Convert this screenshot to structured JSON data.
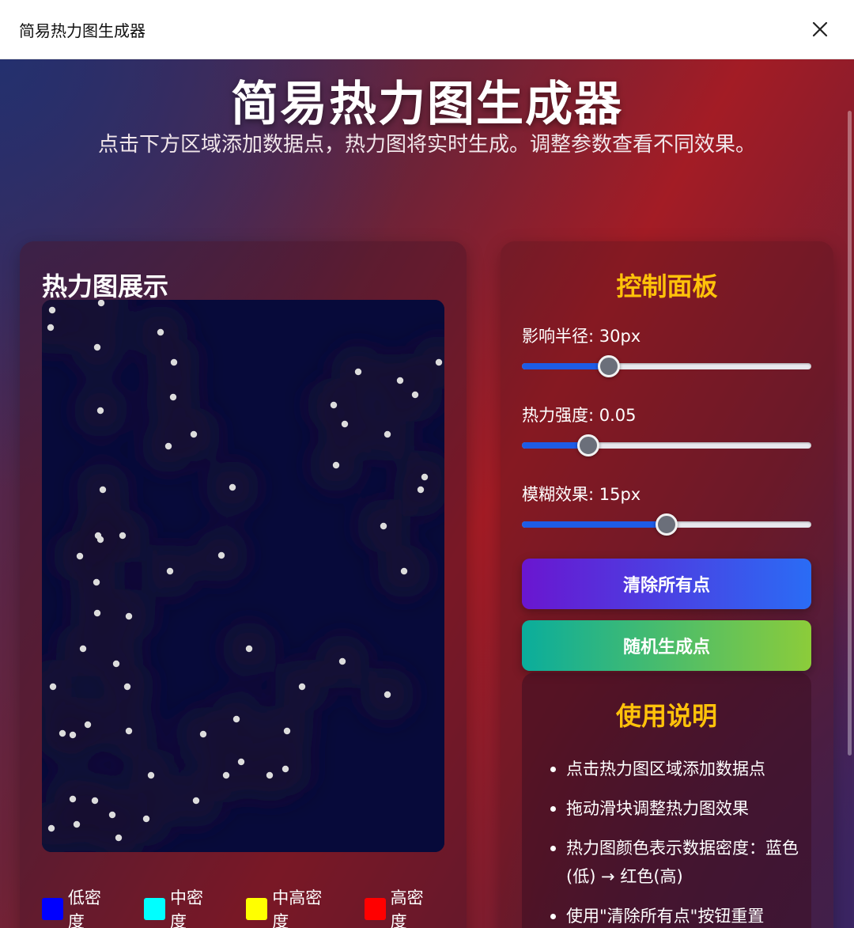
{
  "window": {
    "title": "简易热力图生成器"
  },
  "header": {
    "title": "简易热力图生成器",
    "subtitle": "点击下方区域添加数据点，热力图将实时生成。调整参数查看不同效果。"
  },
  "heatmap": {
    "title": "热力图展示",
    "background_color": "#070a3a",
    "point_color": "#dcdcdc",
    "points": [
      [
        13,
        13
      ],
      [
        75,
        4
      ],
      [
        11,
        35
      ],
      [
        150,
        41
      ],
      [
        70,
        60
      ],
      [
        167,
        79
      ],
      [
        166,
        123
      ],
      [
        74,
        140
      ],
      [
        400,
        91
      ],
      [
        453,
        102
      ],
      [
        472,
        120
      ],
      [
        502,
        79
      ],
      [
        369,
        133
      ],
      [
        383,
        157
      ],
      [
        437,
        170
      ],
      [
        192,
        170
      ],
      [
        160,
        185
      ],
      [
        77,
        240
      ],
      [
        241,
        237
      ],
      [
        372,
        209
      ],
      [
        484,
        224
      ],
      [
        479,
        240
      ],
      [
        71,
        298
      ],
      [
        74,
        303
      ],
      [
        102,
        298
      ],
      [
        48,
        324
      ],
      [
        227,
        323
      ],
      [
        162,
        343
      ],
      [
        69,
        357
      ],
      [
        432,
        286
      ],
      [
        458,
        343
      ],
      [
        70,
        396
      ],
      [
        110,
        400
      ],
      [
        52,
        441
      ],
      [
        94,
        460
      ],
      [
        262,
        441
      ],
      [
        380,
        457
      ],
      [
        14,
        489
      ],
      [
        108,
        489
      ],
      [
        329,
        489
      ],
      [
        437,
        499
      ],
      [
        246,
        530
      ],
      [
        58,
        537
      ],
      [
        26,
        548
      ],
      [
        39,
        550
      ],
      [
        110,
        545
      ],
      [
        204,
        549
      ],
      [
        310,
        545
      ],
      [
        252,
        584
      ],
      [
        308,
        593
      ],
      [
        138,
        601
      ],
      [
        233,
        601
      ],
      [
        288,
        601
      ],
      [
        39,
        631
      ],
      [
        67,
        633
      ],
      [
        195,
        633
      ],
      [
        89,
        651
      ],
      [
        132,
        656
      ],
      [
        12,
        668
      ],
      [
        44,
        663
      ],
      [
        97,
        680
      ]
    ]
  },
  "legend": [
    {
      "label": "低密度",
      "color": "#0000ff"
    },
    {
      "label": "中密度",
      "color": "#00ffff"
    },
    {
      "label": "中高密度",
      "color": "#ffff00"
    },
    {
      "label": "高密度",
      "color": "#ff0000"
    }
  ],
  "controls": {
    "title": "控制面板",
    "sliders": [
      {
        "label": "影响半径: 30px",
        "fraction": 0.3
      },
      {
        "label": "热力强度: 0.05",
        "fraction": 0.23
      },
      {
        "label": "模糊效果: 15px",
        "fraction": 0.5
      }
    ],
    "clear_button": "清除所有点",
    "random_button": "随机生成点"
  },
  "help": {
    "title": "使用说明",
    "items": [
      "点击热力图区域添加数据点",
      "拖动滑块调整热力图效果",
      "热力图颜色表示数据密度：蓝色(低) → 红色(高)",
      "使用\"清除所有点\"按钮重置"
    ]
  }
}
